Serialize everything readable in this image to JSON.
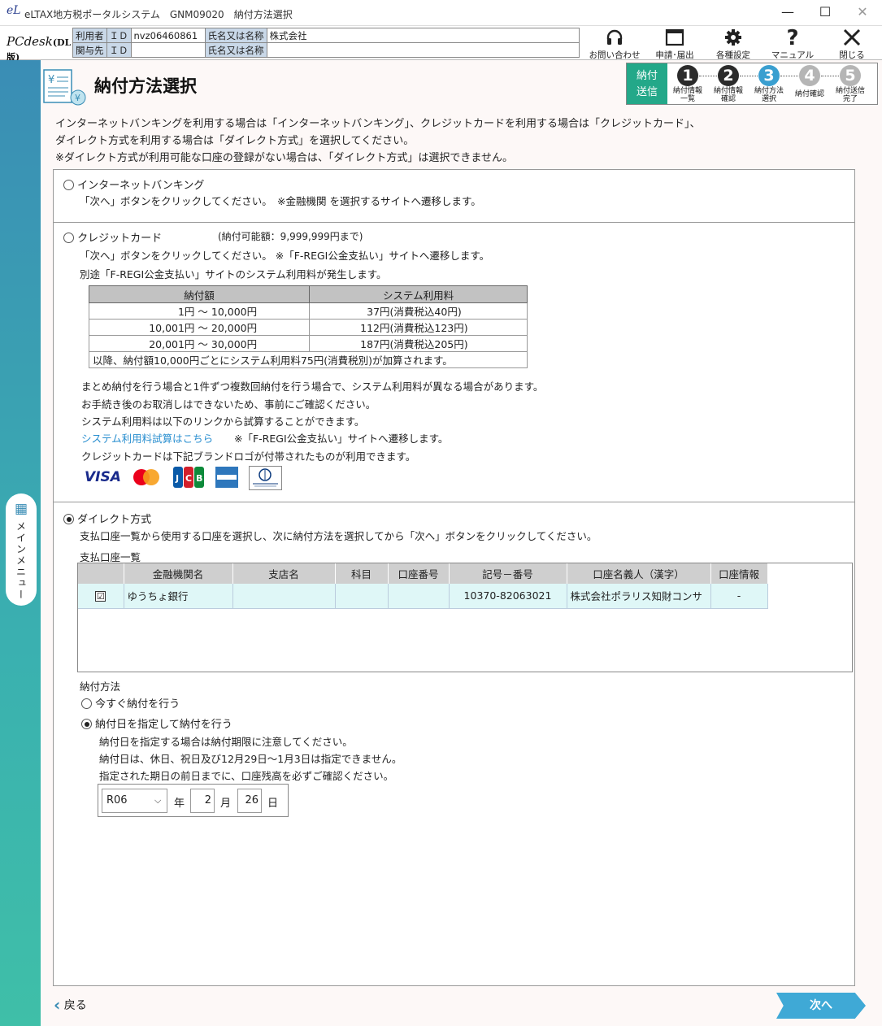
{
  "window": {
    "title": "eLTAX地方税ポータルシステム　GNM09020　納付方法選択",
    "logo": "eL",
    "min": "—",
    "max": "☐",
    "close": "✕"
  },
  "header": {
    "logo_main": "PCdesk",
    "logo_sub": "(DL版)",
    "user_label": "利用者",
    "id_label": "ＩＤ",
    "user_id": "nvz06460861",
    "name_label": "氏名又は名称",
    "user_name": "株式会社",
    "rel_label": "関与先",
    "rel_id_label": "ＩＤ",
    "rel_id": "",
    "rel_name_label": "氏名又は名称",
    "rel_name": ""
  },
  "toolbar": {
    "contact": "お問い合わせ",
    "apply": "申請･届出",
    "settings": "各種設定",
    "manual": "マニュアル",
    "close": "閉じる"
  },
  "sidebar": {
    "menu_label": "メインメニュー",
    "grid_icon": "▦"
  },
  "page": {
    "title": "納付方法選択",
    "badge": "納付\n送信"
  },
  "steps": [
    {
      "num": "1",
      "label": "納付情報\n一覧",
      "state": "done"
    },
    {
      "num": "2",
      "label": "納付情報\n確認",
      "state": "done"
    },
    {
      "num": "3",
      "label": "納付方法\n選択",
      "state": "current"
    },
    {
      "num": "4",
      "label": "納付確認",
      "state": "todo"
    },
    {
      "num": "5",
      "label": "納付送信\n完了",
      "state": "todo"
    }
  ],
  "colors": {
    "done": "#2b2b2b",
    "current": "#3a9fd0",
    "todo": "#b5b5b5",
    "badge": "#23a889"
  },
  "intro": [
    "インターネットバンキングを利用する場合は「インターネットバンキング」、クレジットカードを利用する場合は「クレジットカード」、",
    "ダイレクト方式を利用する場合は「ダイレクト方式」を選択してください。",
    "※ダイレクト方式が利用可能な口座の登録がない場合は、「ダイレクト方式」は選択できません。"
  ],
  "internet": {
    "label": "インターネットバンキング",
    "note": "「次へ」ボタンをクリックしてください。　※金融機関 を選択するサイトへ遷移します。"
  },
  "credit": {
    "label": "クレジットカード",
    "limit": "(納付可能額：9,999,999円まで)",
    "note1": "「次へ」ボタンをクリックしてください。 ※「F-REGI公金支払い」サイトへ遷移します。",
    "note2": "別途「F-REGI公金支払い」サイトのシステム利用料が発生します。",
    "fee_headers": [
      "納付額",
      "システム利用料"
    ],
    "fee_rows": [
      [
        "1円 ～ 10,000円",
        "37円(消費税込40円)"
      ],
      [
        "10,001円 ～ 20,000円",
        "112円(消費税込123円)"
      ],
      [
        "20,001円 ～ 30,000円",
        "187円(消費税込205円)"
      ]
    ],
    "fee_footer": "以降、納付額10,000円ごとにシステム利用料75円(消費税別)が加算されます。",
    "notes": [
      "まとめ納付を行う場合と1件ずつ複数回納付を行う場合で、システム利用料が異なる場合があります。",
      "お手続き後のお取消しはできないため、事前にご確認ください。",
      "システム利用料は以下のリンクから試算することができます。"
    ],
    "link": "システム利用料試算はこちら",
    "link_note": "※「F-REGI公金支払い」サイトへ遷移します。",
    "brand_note": "クレジットカードは下記ブランドロゴが付帯されたものが利用できます。",
    "brands": [
      "VISA",
      "mastercard",
      "JCB",
      "AMERICAN EXPRESS",
      "Diners Club"
    ]
  },
  "direct": {
    "label": "ダイレクト方式",
    "note": "支払口座一覧から使用する口座を選択し、次に納付方法を選択してから「次へ」ボタンをクリックしてください。",
    "list_label": "支払口座一覧",
    "columns": [
      "",
      "金融機関名",
      "支店名",
      "科目",
      "口座番号",
      "記号－番号",
      "口座名義人（漢字）",
      "口座情報"
    ],
    "rows": [
      {
        "checked": "☑",
        "bank": "ゆうちょ銀行",
        "branch": "",
        "subject": "",
        "account": "",
        "code": "10370-82063021",
        "holder": "株式会社ポラリス知財コンサ",
        "info": "-"
      }
    ],
    "method_label": "納付方法",
    "now_label": "今すぐ納付を行う",
    "date_label": "納付日を指定して納付を行う",
    "date_notes": [
      "納付日を指定する場合は納付期限に注意してください。",
      "納付日は、休日、祝日及び12月29日～1月3日は指定できません。",
      "指定された期日の前日までに、口座残高を必ずご確認ください。"
    ],
    "era": "R06",
    "year_unit": "年",
    "month": "2",
    "month_unit": "月",
    "day": "26",
    "day_unit": "日"
  },
  "nav": {
    "back": "戻る",
    "next": "次へ"
  }
}
